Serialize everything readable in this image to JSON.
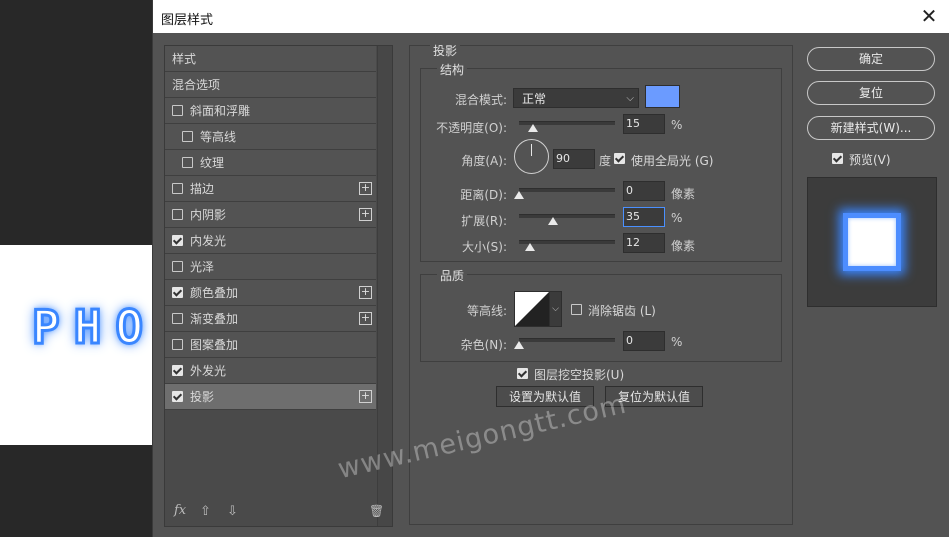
{
  "canvas": {
    "text": "PHO"
  },
  "dialog": {
    "title": "图层样式",
    "close_symbol": "✕"
  },
  "styles_list": {
    "header": "样式",
    "blend_options": "混合选项",
    "items": [
      {
        "label": "斜面和浮雕",
        "checked": false,
        "indent": false,
        "plus": false,
        "active": false
      },
      {
        "label": "等高线",
        "checked": false,
        "indent": true,
        "plus": false,
        "active": false
      },
      {
        "label": "纹理",
        "checked": false,
        "indent": true,
        "plus": false,
        "active": false
      },
      {
        "label": "描边",
        "checked": false,
        "indent": false,
        "plus": true,
        "active": false
      },
      {
        "label": "内阴影",
        "checked": false,
        "indent": false,
        "plus": true,
        "active": false
      },
      {
        "label": "内发光",
        "checked": true,
        "indent": false,
        "plus": false,
        "active": false
      },
      {
        "label": "光泽",
        "checked": false,
        "indent": false,
        "plus": false,
        "active": false
      },
      {
        "label": "颜色叠加",
        "checked": true,
        "indent": false,
        "plus": true,
        "active": false
      },
      {
        "label": "渐变叠加",
        "checked": false,
        "indent": false,
        "plus": true,
        "active": false
      },
      {
        "label": "图案叠加",
        "checked": false,
        "indent": false,
        "plus": false,
        "active": false
      },
      {
        "label": "外发光",
        "checked": true,
        "indent": false,
        "plus": false,
        "active": false
      },
      {
        "label": "投影",
        "checked": true,
        "indent": false,
        "plus": true,
        "active": true
      }
    ],
    "plus_symbol": "+",
    "fx_label": "fx",
    "up_symbol": "⇧",
    "down_symbol": "⇩",
    "trash_symbol": "🗑"
  },
  "drop_shadow": {
    "section_title": "投影",
    "structure": {
      "title": "结构",
      "blend_mode_label": "混合模式:",
      "blend_mode_value": "正常",
      "blend_color": "#6b9bff",
      "opacity_label": "不透明度(O):",
      "opacity_value": "15",
      "opacity_unit": "%",
      "opacity_fraction": 0.15,
      "angle_label": "角度(A):",
      "angle_value": "90",
      "angle_unit": "度",
      "global_light_label": "使用全局光 (G)",
      "global_light_checked": true,
      "distance_label": "距离(D):",
      "distance_value": "0",
      "distance_unit": "像素",
      "spread_label": "扩展(R):",
      "spread_value": "35",
      "spread_unit": "%",
      "size_label": "大小(S):",
      "size_value": "12",
      "size_unit": "像素"
    },
    "quality": {
      "title": "品质",
      "contour_label": "等高线:",
      "anti_alias_label": "消除锯齿 (L)",
      "anti_alias_checked": false,
      "noise_label": "杂色(N):",
      "noise_value": "0",
      "noise_unit": "%"
    },
    "knockout_label": "图层挖空投影(U)",
    "knockout_checked": true,
    "make_default_label": "设置为默认值",
    "reset_default_label": "复位为默认值"
  },
  "right_panel": {
    "ok_label": "确定",
    "reset_label": "复位",
    "new_style_label": "新建样式(W)...",
    "preview_label": "预览(V)",
    "preview_checked": true
  },
  "watermark": "www.meigongtt.com",
  "colors": {
    "accent": "#4a90ff",
    "glow": "#3a86ff"
  }
}
